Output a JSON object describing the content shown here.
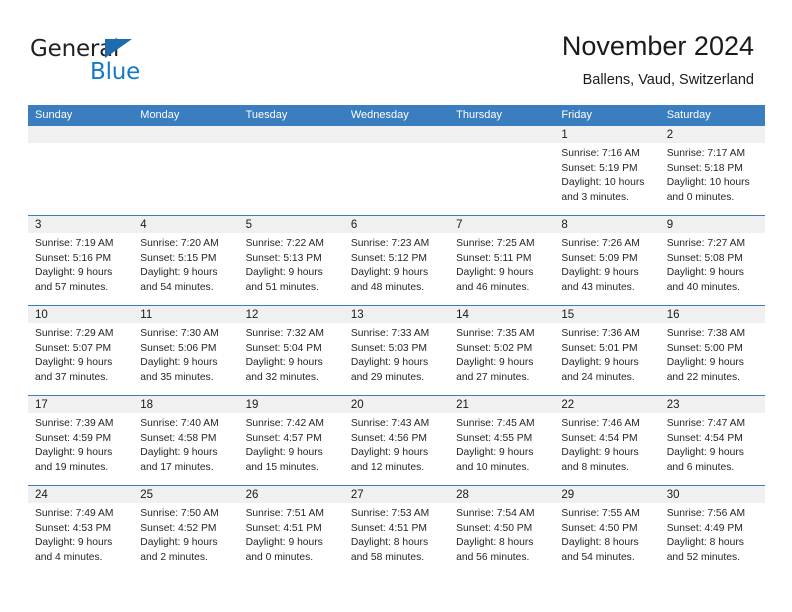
{
  "brand": {
    "name_part1": "General",
    "name_part2": "Blue",
    "logo_icon": "triangle-logo-icon"
  },
  "header": {
    "title": "November 2024",
    "subtitle": "Ballens, Vaud, Switzerland"
  },
  "colors": {
    "header_blue": "#3a7ebf",
    "brand_blue": "#1679c4",
    "daynum_band": "#f0f0f0",
    "text": "#1a1a1a"
  },
  "weekdays": [
    "Sunday",
    "Monday",
    "Tuesday",
    "Wednesday",
    "Thursday",
    "Friday",
    "Saturday"
  ],
  "labels": {
    "sunrise": "Sunrise:",
    "sunset": "Sunset:",
    "daylight": "Daylight:"
  },
  "weeks": [
    [
      {
        "day": "",
        "sunrise": "",
        "sunset": "",
        "daylight_line1": "",
        "daylight_line2": "",
        "empty": true
      },
      {
        "day": "",
        "sunrise": "",
        "sunset": "",
        "daylight_line1": "",
        "daylight_line2": "",
        "empty": true
      },
      {
        "day": "",
        "sunrise": "",
        "sunset": "",
        "daylight_line1": "",
        "daylight_line2": "",
        "empty": true
      },
      {
        "day": "",
        "sunrise": "",
        "sunset": "",
        "daylight_line1": "",
        "daylight_line2": "",
        "empty": true
      },
      {
        "day": "",
        "sunrise": "",
        "sunset": "",
        "daylight_line1": "",
        "daylight_line2": "",
        "empty": true
      },
      {
        "day": "1",
        "sunrise": "Sunrise: 7:16 AM",
        "sunset": "Sunset: 5:19 PM",
        "daylight_line1": "Daylight: 10 hours",
        "daylight_line2": "and 3 minutes."
      },
      {
        "day": "2",
        "sunrise": "Sunrise: 7:17 AM",
        "sunset": "Sunset: 5:18 PM",
        "daylight_line1": "Daylight: 10 hours",
        "daylight_line2": "and 0 minutes."
      }
    ],
    [
      {
        "day": "3",
        "sunrise": "Sunrise: 7:19 AM",
        "sunset": "Sunset: 5:16 PM",
        "daylight_line1": "Daylight: 9 hours",
        "daylight_line2": "and 57 minutes."
      },
      {
        "day": "4",
        "sunrise": "Sunrise: 7:20 AM",
        "sunset": "Sunset: 5:15 PM",
        "daylight_line1": "Daylight: 9 hours",
        "daylight_line2": "and 54 minutes."
      },
      {
        "day": "5",
        "sunrise": "Sunrise: 7:22 AM",
        "sunset": "Sunset: 5:13 PM",
        "daylight_line1": "Daylight: 9 hours",
        "daylight_line2": "and 51 minutes."
      },
      {
        "day": "6",
        "sunrise": "Sunrise: 7:23 AM",
        "sunset": "Sunset: 5:12 PM",
        "daylight_line1": "Daylight: 9 hours",
        "daylight_line2": "and 48 minutes."
      },
      {
        "day": "7",
        "sunrise": "Sunrise: 7:25 AM",
        "sunset": "Sunset: 5:11 PM",
        "daylight_line1": "Daylight: 9 hours",
        "daylight_line2": "and 46 minutes."
      },
      {
        "day": "8",
        "sunrise": "Sunrise: 7:26 AM",
        "sunset": "Sunset: 5:09 PM",
        "daylight_line1": "Daylight: 9 hours",
        "daylight_line2": "and 43 minutes."
      },
      {
        "day": "9",
        "sunrise": "Sunrise: 7:27 AM",
        "sunset": "Sunset: 5:08 PM",
        "daylight_line1": "Daylight: 9 hours",
        "daylight_line2": "and 40 minutes."
      }
    ],
    [
      {
        "day": "10",
        "sunrise": "Sunrise: 7:29 AM",
        "sunset": "Sunset: 5:07 PM",
        "daylight_line1": "Daylight: 9 hours",
        "daylight_line2": "and 37 minutes."
      },
      {
        "day": "11",
        "sunrise": "Sunrise: 7:30 AM",
        "sunset": "Sunset: 5:06 PM",
        "daylight_line1": "Daylight: 9 hours",
        "daylight_line2": "and 35 minutes."
      },
      {
        "day": "12",
        "sunrise": "Sunrise: 7:32 AM",
        "sunset": "Sunset: 5:04 PM",
        "daylight_line1": "Daylight: 9 hours",
        "daylight_line2": "and 32 minutes."
      },
      {
        "day": "13",
        "sunrise": "Sunrise: 7:33 AM",
        "sunset": "Sunset: 5:03 PM",
        "daylight_line1": "Daylight: 9 hours",
        "daylight_line2": "and 29 minutes."
      },
      {
        "day": "14",
        "sunrise": "Sunrise: 7:35 AM",
        "sunset": "Sunset: 5:02 PM",
        "daylight_line1": "Daylight: 9 hours",
        "daylight_line2": "and 27 minutes."
      },
      {
        "day": "15",
        "sunrise": "Sunrise: 7:36 AM",
        "sunset": "Sunset: 5:01 PM",
        "daylight_line1": "Daylight: 9 hours",
        "daylight_line2": "and 24 minutes."
      },
      {
        "day": "16",
        "sunrise": "Sunrise: 7:38 AM",
        "sunset": "Sunset: 5:00 PM",
        "daylight_line1": "Daylight: 9 hours",
        "daylight_line2": "and 22 minutes."
      }
    ],
    [
      {
        "day": "17",
        "sunrise": "Sunrise: 7:39 AM",
        "sunset": "Sunset: 4:59 PM",
        "daylight_line1": "Daylight: 9 hours",
        "daylight_line2": "and 19 minutes."
      },
      {
        "day": "18",
        "sunrise": "Sunrise: 7:40 AM",
        "sunset": "Sunset: 4:58 PM",
        "daylight_line1": "Daylight: 9 hours",
        "daylight_line2": "and 17 minutes."
      },
      {
        "day": "19",
        "sunrise": "Sunrise: 7:42 AM",
        "sunset": "Sunset: 4:57 PM",
        "daylight_line1": "Daylight: 9 hours",
        "daylight_line2": "and 15 minutes."
      },
      {
        "day": "20",
        "sunrise": "Sunrise: 7:43 AM",
        "sunset": "Sunset: 4:56 PM",
        "daylight_line1": "Daylight: 9 hours",
        "daylight_line2": "and 12 minutes."
      },
      {
        "day": "21",
        "sunrise": "Sunrise: 7:45 AM",
        "sunset": "Sunset: 4:55 PM",
        "daylight_line1": "Daylight: 9 hours",
        "daylight_line2": "and 10 minutes."
      },
      {
        "day": "22",
        "sunrise": "Sunrise: 7:46 AM",
        "sunset": "Sunset: 4:54 PM",
        "daylight_line1": "Daylight: 9 hours",
        "daylight_line2": "and 8 minutes."
      },
      {
        "day": "23",
        "sunrise": "Sunrise: 7:47 AM",
        "sunset": "Sunset: 4:54 PM",
        "daylight_line1": "Daylight: 9 hours",
        "daylight_line2": "and 6 minutes."
      }
    ],
    [
      {
        "day": "24",
        "sunrise": "Sunrise: 7:49 AM",
        "sunset": "Sunset: 4:53 PM",
        "daylight_line1": "Daylight: 9 hours",
        "daylight_line2": "and 4 minutes."
      },
      {
        "day": "25",
        "sunrise": "Sunrise: 7:50 AM",
        "sunset": "Sunset: 4:52 PM",
        "daylight_line1": "Daylight: 9 hours",
        "daylight_line2": "and 2 minutes."
      },
      {
        "day": "26",
        "sunrise": "Sunrise: 7:51 AM",
        "sunset": "Sunset: 4:51 PM",
        "daylight_line1": "Daylight: 9 hours",
        "daylight_line2": "and 0 minutes."
      },
      {
        "day": "27",
        "sunrise": "Sunrise: 7:53 AM",
        "sunset": "Sunset: 4:51 PM",
        "daylight_line1": "Daylight: 8 hours",
        "daylight_line2": "and 58 minutes."
      },
      {
        "day": "28",
        "sunrise": "Sunrise: 7:54 AM",
        "sunset": "Sunset: 4:50 PM",
        "daylight_line1": "Daylight: 8 hours",
        "daylight_line2": "and 56 minutes."
      },
      {
        "day": "29",
        "sunrise": "Sunrise: 7:55 AM",
        "sunset": "Sunset: 4:50 PM",
        "daylight_line1": "Daylight: 8 hours",
        "daylight_line2": "and 54 minutes."
      },
      {
        "day": "30",
        "sunrise": "Sunrise: 7:56 AM",
        "sunset": "Sunset: 4:49 PM",
        "daylight_line1": "Daylight: 8 hours",
        "daylight_line2": "and 52 minutes."
      }
    ]
  ]
}
